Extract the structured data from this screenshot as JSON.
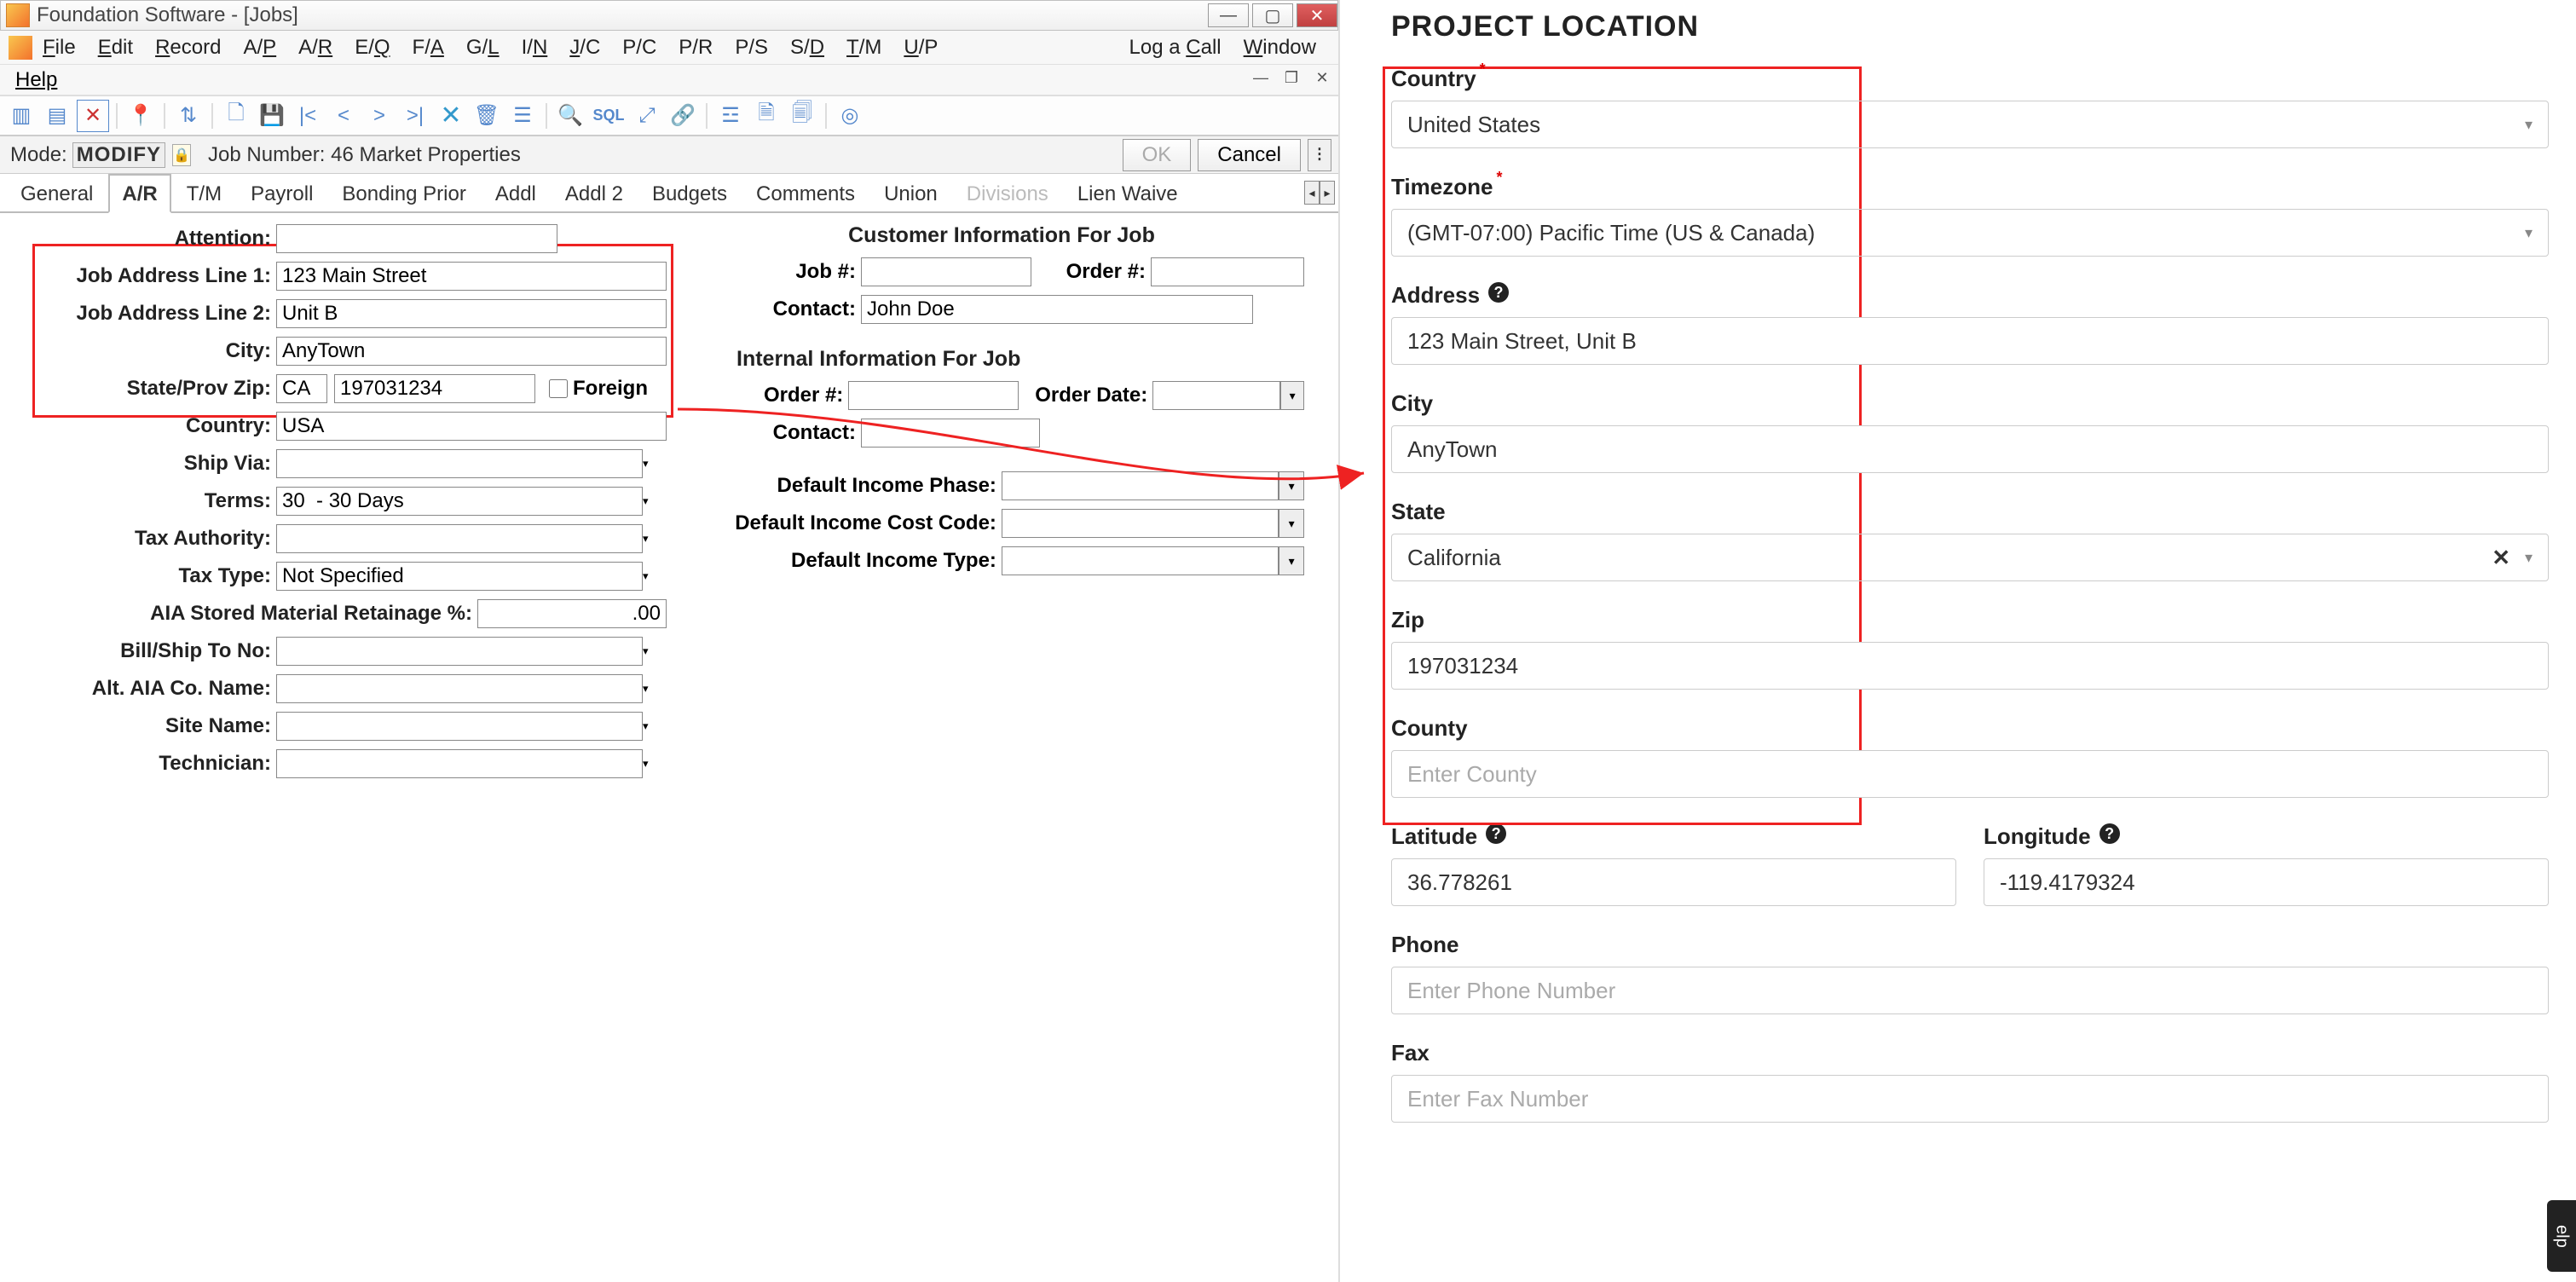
{
  "left_app": {
    "titlebar": "Foundation Software - [Jobs]",
    "menubar": [
      "File",
      "Edit",
      "Record",
      "A/P",
      "A/R",
      "E/Q",
      "F/A",
      "G/L",
      "I/N",
      "J/C",
      "P/C",
      "P/R",
      "P/S",
      "S/D",
      "T/M",
      "U/P"
    ],
    "menubar_right": [
      "Log a Call",
      "Window"
    ],
    "help_menu": "Help",
    "mode_label": "Mode:",
    "mode_value": "MODIFY",
    "job_info": "Job Number: 46  Market Properties",
    "ok_btn": "OK",
    "cancel_btn": "Cancel",
    "tabs": [
      "General",
      "A/R",
      "T/M",
      "Payroll",
      "Bonding Prior",
      "Addl",
      "Addl 2",
      "Budgets",
      "Comments",
      "Union",
      "Divisions",
      "Lien Waive"
    ],
    "active_tab": "A/R",
    "disabled_tab": "Divisions",
    "fields": {
      "attention_label": "Attention:",
      "attention": "",
      "addr1_label": "Job Address Line 1:",
      "addr1": "123 Main Street",
      "addr2_label": "Job Address Line 2:",
      "addr2": "Unit B",
      "city_label": "City:",
      "city": "AnyTown",
      "stateprov_label": "State/Prov Zip:",
      "state": "CA",
      "zip": "197031234",
      "foreign_label": "Foreign",
      "country_label": "Country:",
      "country": "USA",
      "shipvia_label": "Ship Via:",
      "shipvia": "",
      "terms_label": "Terms:",
      "terms": "30  - 30 Days",
      "taxauth_label": "Tax Authority:",
      "taxauth": "",
      "taxtype_label": "Tax Type:",
      "taxtype": "Not Specified",
      "aia_label": "AIA Stored Material Retainage %:",
      "aia": ".00",
      "billship_label": "Bill/Ship To No:",
      "billship": "",
      "altaia_label": "Alt. AIA Co. Name:",
      "altaia": "",
      "sitename_label": "Site Name:",
      "sitename": "",
      "technician_label": "Technician:",
      "technician": ""
    },
    "right_col": {
      "cust_header": "Customer Information For Job",
      "jobnum_label": "Job #:",
      "jobnum": "",
      "ordernum_label": "Order #:",
      "ordernum": "",
      "contact_label": "Contact:",
      "contact": "John Doe",
      "int_header": "Internal Information For Job",
      "int_ordernum_label": "Order #:",
      "int_ordernum": "",
      "orderdate_label": "Order Date:",
      "orderdate": "",
      "int_contact_label": "Contact:",
      "int_contact": "",
      "di_phase_label": "Default Income Phase:",
      "di_phase": "",
      "di_cost_label": "Default Income Cost Code:",
      "di_cost": "",
      "di_type_label": "Default Income Type:",
      "di_type": ""
    }
  },
  "right_form": {
    "heading": "PROJECT LOCATION",
    "country_label": "Country",
    "country": "United States",
    "timezone_label": "Timezone",
    "timezone": "(GMT-07:00) Pacific Time (US & Canada)",
    "address_label": "Address",
    "address": "123 Main Street, Unit B",
    "city_label": "City",
    "city": "AnyTown",
    "state_label": "State",
    "state": "California",
    "zip_label": "Zip",
    "zip": "197031234",
    "county_label": "County",
    "county_placeholder": "Enter County",
    "latitude_label": "Latitude",
    "latitude": "36.778261",
    "longitude_label": "Longitude",
    "longitude": "-119.4179324",
    "phone_label": "Phone",
    "phone_placeholder": "Enter Phone Number",
    "fax_label": "Fax",
    "fax_placeholder": "Enter Fax Number"
  },
  "help_tab": "elp"
}
